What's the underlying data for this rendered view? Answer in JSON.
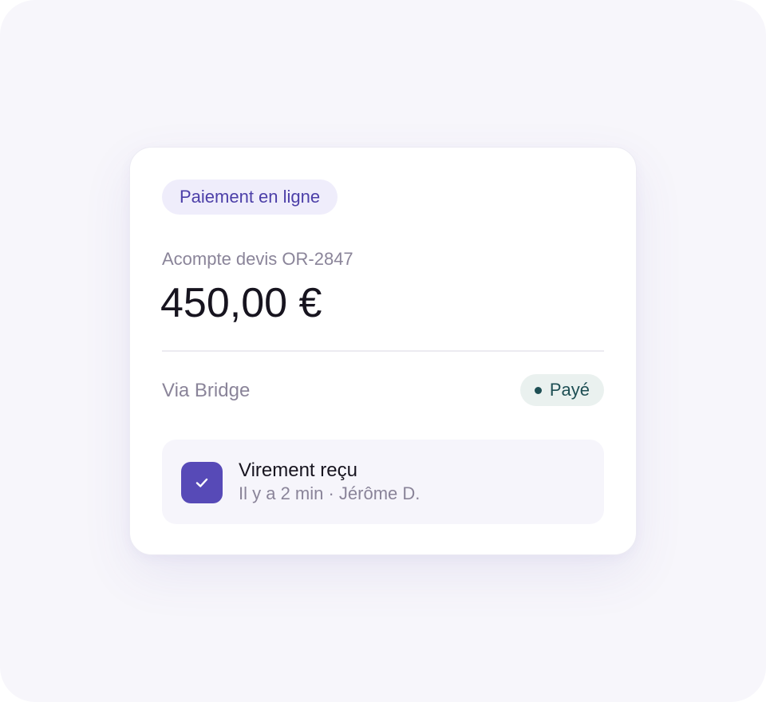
{
  "card": {
    "tag": "Paiement en ligne",
    "subtitle": "Acompte devis OR-2847",
    "amount": "450,00 €",
    "via": "Via Bridge",
    "status": {
      "label": "Payé",
      "color": "#1e4f54"
    }
  },
  "event": {
    "icon": "check-icon",
    "title": "Virement reçu",
    "meta": "Il y a 2 min · Jérôme D."
  },
  "colors": {
    "accent": "#574ab7",
    "tag_text": "#4c3fa8",
    "status_bg": "#eaf1ef",
    "background": "#f7f6fb"
  }
}
